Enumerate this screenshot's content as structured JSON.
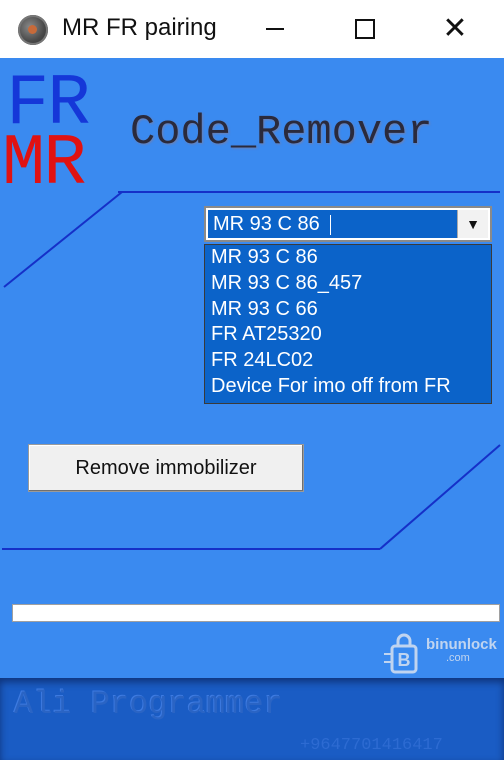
{
  "window": {
    "title": "MR FR pairing",
    "icon": "app-icon"
  },
  "logo": {
    "top": "FR",
    "bottom": "MR",
    "top_color": "#1537d8",
    "bottom_color": "#e01212"
  },
  "brand": "Code_Remover",
  "device_select": {
    "selected": "MR 93 C 86",
    "options": [
      "MR 93 C 86",
      "MR 93 C 86_457",
      "MR 93 C 66",
      "FR AT25320",
      "FR 24LC02",
      "Device For imo off from FR"
    ]
  },
  "actions": {
    "remove_label": "Remove immobilizer"
  },
  "progress": {
    "value": 0
  },
  "footer": {
    "programmer": "Ali Programmer",
    "phone": "+9647701416417"
  },
  "watermark": {
    "name": "binunlock",
    "domain": ".com"
  },
  "colors": {
    "background": "#3a8af0",
    "selection": "#0b63c9",
    "footer": "#1a5cc4"
  }
}
